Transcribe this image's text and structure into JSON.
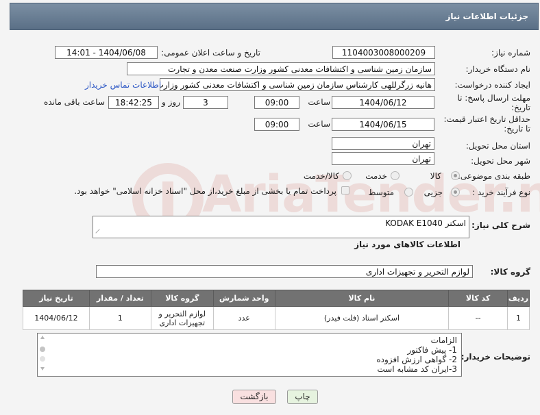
{
  "header": {
    "title": "جزئیات اطلاعات نیاز"
  },
  "form": {
    "need_number": {
      "label": "شماره نیاز:",
      "value": "1104003008000209"
    },
    "announce": {
      "label": "تاریخ و ساعت اعلان عمومی:",
      "value": "1404/06/08 - 14:01"
    },
    "buyer_org": {
      "label": "نام دستگاه خریدار:",
      "value": "سازمان زمین شناسی و اکتشافات معدنی کشور وزارت صنعت معدن و تجارت"
    },
    "requester": {
      "label": "ایجاد کننده درخواست:",
      "value": "هانیه زرگرللهی کارشناس سازمان زمین شناسی و اکتشافات معدنی کشور وزارت",
      "contact_link": "اطلاعات تماس خریدار"
    },
    "reply_deadline": {
      "label_line1": "مهلت ارسال پاسخ: تا",
      "label_line2": "تاریخ:",
      "date": "1404/06/12",
      "time_label": "ساعت",
      "time": "09:00",
      "days": "3",
      "days_label": "روز و",
      "remaining": "18:42:25",
      "remaining_label": "ساعت باقی مانده"
    },
    "price_deadline": {
      "label_line1": "حداقل تاریخ اعتبار قیمت:",
      "label_line2": "تا تاریخ:",
      "date": "1404/06/15",
      "time_label": "ساعت",
      "time": "09:00"
    },
    "delivery_province": {
      "label": "استان محل تحویل:",
      "value": "تهران"
    },
    "delivery_city": {
      "label": "شهر محل تحویل:",
      "value": "تهران"
    },
    "category": {
      "label": "طبقه بندی موضوعی:",
      "options": [
        "کالا",
        "خدمت",
        "کالا/خدمت"
      ],
      "selected": "کالا"
    },
    "purchase_type": {
      "label": "نوع فرآیند خرید :",
      "options": [
        "جزیی",
        "متوسط"
      ],
      "selected": "جزیی",
      "payment_note": "پرداخت تمام یا بخشی از مبلغ خرید،از محل \"اسناد خزانه اسلامی\" خواهد بود."
    }
  },
  "description": {
    "label": "شرح کلی نیاز:",
    "value": "اسکنر KODAK E1040"
  },
  "goods_section": {
    "title": "اطلاعات کالاهای مورد نیاز"
  },
  "goods_group": {
    "label": "گروه کالا:",
    "value": "لوازم التحریر و تجهیزات اداری"
  },
  "table": {
    "headers": [
      "ردیف",
      "کد کالا",
      "نام کالا",
      "واحد شمارش",
      "گروه کالا",
      "تعداد / مقدار",
      "تاریخ نیاز"
    ],
    "rows": [
      {
        "row": "1",
        "code": "--",
        "name": "اسکنر اسناد (فلت فیدر)",
        "unit": "عدد",
        "group_line1": "لوازم التحریر و",
        "group_line2": "تجهیزات اداری",
        "qty": "1",
        "date": "1404/06/12"
      }
    ]
  },
  "buyer_notes": {
    "label": "توضیحات خریدار:",
    "lines": [
      "الزامات",
      "1-  پیش فاکتور",
      "2- گواهی ارزش افزوده",
      "3-ایران کد مشابه است"
    ]
  },
  "buttons": {
    "print": "چاپ",
    "back": "بازگشت"
  },
  "watermark": "AriaTender.neT",
  "colors": {
    "header": "#6b7f95",
    "link": "#2a55c4",
    "table_header": "#727272",
    "print_button": "#e6f3df",
    "back_button": "#f9e0e0"
  }
}
